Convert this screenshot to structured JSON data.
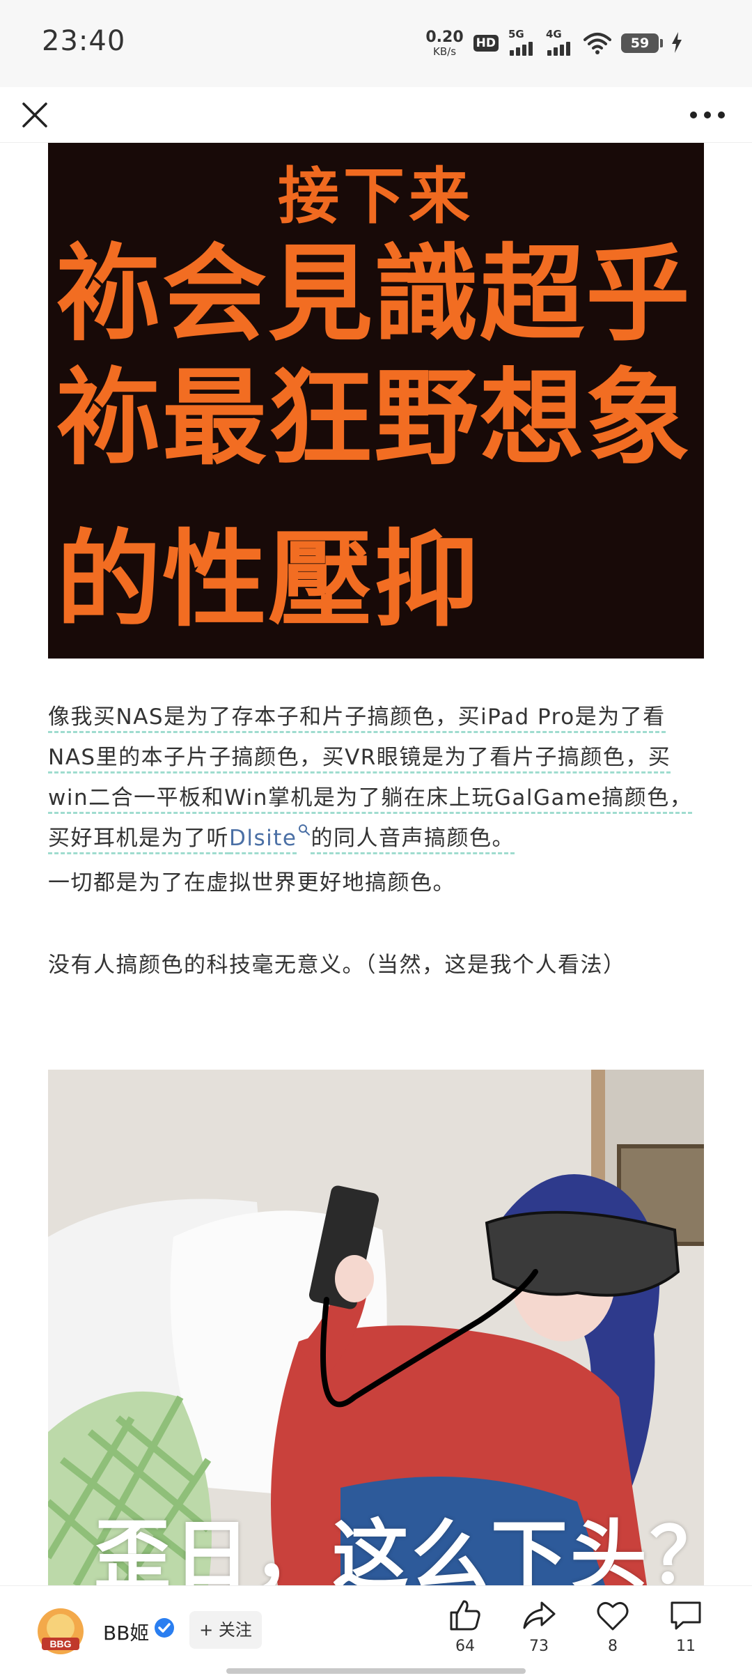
{
  "status_bar": {
    "time": "23:40",
    "net_speed_value": "0.20",
    "net_speed_unit": "KB/s",
    "hd_label": "HD",
    "sim1_label": "5G",
    "sim2_label": "4G",
    "battery_level": "59"
  },
  "article": {
    "image1_text": {
      "line0": "接下来",
      "line1": "袮会見識超乎",
      "line2": "袮最狂野想象",
      "line3": "的性壓抑"
    },
    "paragraph1": {
      "text_before_link": "像我买NAS是为了存本子和片子搞颜色，买iPad Pro是为了看NAS里的本子片子搞颜色，买VR眼镜是为了看片子搞颜色，买win二合一平板和Win掌机是为了躺在床上玩GalGame搞颜色，买好耳机是为了听",
      "link_text": "Dlsite",
      "text_after_link": "的同人音声搞颜色。"
    },
    "paragraph2": "一切都是为了在虚拟世界更好地搞颜色。",
    "paragraph3": "没有人搞颜色的科技毫无意义。（当然，这是我个人看法）",
    "image2_caption": "歪日，这么下头？"
  },
  "bottom_bar": {
    "author_name": "BB姬",
    "follow_label": "+ 关注",
    "avatar_text": "BBG",
    "likes": "64",
    "shares": "73",
    "favorites": "8",
    "comments": "11"
  },
  "colors": {
    "meme_orange": "#f26d22",
    "meme_bg": "#180a08",
    "link_blue": "#4a6fa5",
    "underline_teal": "#9fdccf",
    "verified_blue": "#2a7ef0"
  }
}
